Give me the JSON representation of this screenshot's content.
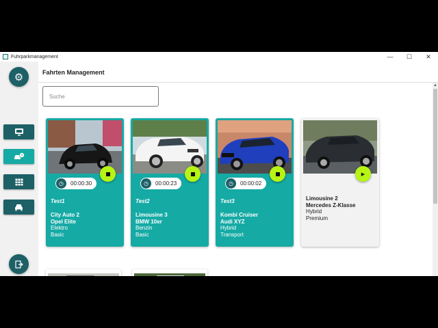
{
  "window": {
    "title": "Fuhrparkmanagement",
    "controls": {
      "minimize": "—",
      "maximize": "☐",
      "close": "✕"
    }
  },
  "sidebar": {
    "settings_icon": "gear-icon",
    "nav": [
      {
        "icon": "monitor-icon",
        "active": false
      },
      {
        "icon": "car-clock-icon",
        "active": true
      },
      {
        "icon": "table-icon",
        "active": false
      },
      {
        "icon": "car-icon",
        "active": false
      }
    ],
    "logout_icon": "logout-icon"
  },
  "page": {
    "title": "Fahrten Management",
    "search_placeholder": "Suche"
  },
  "colors": {
    "teal": "#16aaa5",
    "dark_teal": "#1d6066",
    "lime": "#b6f414",
    "card_grey": "#f2f2f2"
  },
  "cards": [
    {
      "status": "running",
      "timer": "00:00:30",
      "trip_name": "Test1",
      "vehicle_name": "City Auto 2",
      "model": "Opel Elite",
      "fuel": "Elektro",
      "tier": "Basic",
      "action_icon": "stop-icon"
    },
    {
      "status": "running",
      "timer": "00:00:23",
      "trip_name": "Test2",
      "vehicle_name": "Limousine 3",
      "model": "BMW 10er",
      "fuel": "Benzin",
      "tier": "Basic",
      "action_icon": "stop-icon"
    },
    {
      "status": "running",
      "timer": "00:00:02",
      "trip_name": "Test3",
      "vehicle_name": "Kombi Cruiser",
      "model": "Audi XYZ",
      "fuel": "Hybrid",
      "tier": "Transport",
      "action_icon": "stop-icon"
    },
    {
      "status": "idle",
      "vehicle_name": "Limousine 2",
      "model": "Mercedes Z-Klasse",
      "fuel": "Hybrid",
      "tier": "Premium",
      "action_icon": "play-icon"
    }
  ]
}
